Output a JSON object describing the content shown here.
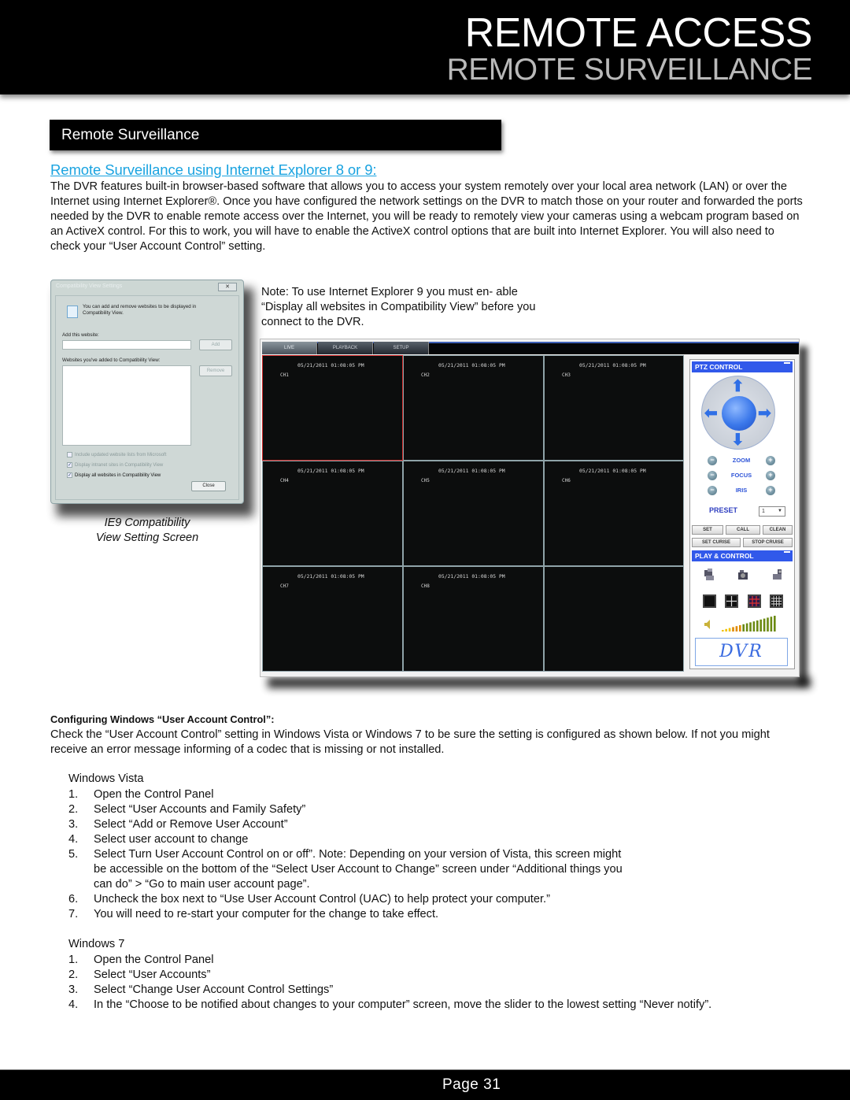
{
  "header": {
    "title": "REMOTE ACCESS",
    "subtitle": "REMOTE SURVEILLANCE"
  },
  "section_bar": {
    "label": "Remote Surveillance"
  },
  "subheading": "Remote Surveillance using Internet Explorer 8 or 9:",
  "intro_paragraph": "The DVR features built-in browser-based software that allows you to access your system remotely over your local area network (LAN) or over the Internet using Internet Explorer®. Once you have configured the network settings on the DVR to match those on your router and forwarded the ports needed by the DVR to enable remote access over the Internet, you will be ready to remotely view your cameras using a webcam program based on an ActiveX control. For this to work, you will have to enable the ActiveX control options that are built into Internet Explorer.  You will also need to check your “User Account Control” setting.",
  "ie9_dialog": {
    "title": "Compatibility View Settings",
    "close_glyph": "✕",
    "info_text": "You can add and remove websites to be displayed in Compatibility View.",
    "add_label": "Add this website:",
    "add_value": "",
    "add_button": "Add",
    "list_label": "Websites you've added to Compatibility View:",
    "remove_button": "Remove",
    "checkboxes": [
      {
        "label": "Include updated website lists from Microsoft",
        "checked": false
      },
      {
        "label": "Display intranet sites in Compatibility View",
        "checked": true
      },
      {
        "label": "Display all websites in Compatibility View",
        "checked": true
      }
    ],
    "close_button": "Close"
  },
  "caption": {
    "line1": "IE9 Compatibility",
    "line2": "View Setting Screen"
  },
  "note": "Note: To use Internet Explorer 9 you must en- able “Display all websites in Compatibility View” before you connect to the DVR.",
  "dvr_app": {
    "tabs": [
      {
        "label": "LIVE",
        "active": true
      },
      {
        "label": "PLAYBACK",
        "active": false
      },
      {
        "label": "SETUP",
        "active": false
      }
    ],
    "cells": [
      {
        "timestamp": "05/21/2011 01:08:05 PM",
        "channel": "CH1",
        "selected": true
      },
      {
        "timestamp": "05/21/2011 01:08:05 PM",
        "channel": "CH2",
        "selected": false
      },
      {
        "timestamp": "05/21/2011 01:08:05 PM",
        "channel": "CH3",
        "selected": false
      },
      {
        "timestamp": "05/21/2011 01:08:05 PM",
        "channel": "CH4",
        "selected": false
      },
      {
        "timestamp": "05/21/2011 01:08:05 PM",
        "channel": "CH5",
        "selected": false
      },
      {
        "timestamp": "05/21/2011 01:08:05 PM",
        "channel": "CH6",
        "selected": false
      },
      {
        "timestamp": "05/21/2011 01:08:05 PM",
        "channel": "CH7",
        "selected": false
      },
      {
        "timestamp": "05/21/2011 01:08:05 PM",
        "channel": "CH8",
        "selected": false
      },
      {
        "timestamp": "",
        "channel": "",
        "selected": false
      }
    ],
    "ptz_header": "PTZ CONTROL",
    "controls": [
      {
        "label": "ZOOM",
        "minus": "−",
        "plus": "+"
      },
      {
        "label": "FOCUS",
        "minus": "−",
        "plus": "+"
      },
      {
        "label": "IRIS",
        "minus": "−",
        "plus": "+"
      }
    ],
    "preset_label": "PRESET",
    "preset_value": "1",
    "buttons": {
      "set": "SET",
      "call": "CALL",
      "clean": "CLEAN",
      "set_cruise": "SET CURISE",
      "stop_cruise": "STOP CRUISE"
    },
    "play_header": "PLAY & CONTROL",
    "logo_text": "DVR",
    "volume_level": 1.0,
    "accent_color": "#3159ea"
  },
  "uac": {
    "heading": "Configuring Windows “User Account Control”:",
    "body": "Check the “User Account Control” setting in Windows Vista or Windows 7 to be sure the setting is configured as shown below. If not you might receive an error message informing of a codec that is missing or not installed.",
    "vista": {
      "title": "Windows Vista",
      "steps": [
        {
          "n": "1.",
          "text": "Open the Control Panel"
        },
        {
          "n": "2.",
          "text": "Select “User Accounts and Family Safety”"
        },
        {
          "n": "3.",
          "text": "Select “Add or Remove User Account”"
        },
        {
          "n": "4.",
          "text": "Select user account to change"
        },
        {
          "n": "5.",
          "text": "Select Turn User Account Control on or off”. Note: Depending on your version of Vista, this screen might be accessible on the bottom of the “Select User Account to Change” screen under “Additional things you can do” > “Go to main user account page”."
        },
        {
          "n": "6.",
          "text": "Uncheck the box next to “Use User Account Control (UAC) to help protect your computer.”"
        },
        {
          "n": "7.",
          "text": "You will need to re-start your computer for the change to take effect."
        }
      ]
    },
    "win7": {
      "title": "Windows 7",
      "steps": [
        {
          "n": "1.",
          "text": "Open the Control Panel"
        },
        {
          "n": "2.",
          "text": "Select “User Accounts”"
        },
        {
          "n": "3.",
          "text": "Select “Change User Account Control Settings”"
        },
        {
          "n": "4.",
          "text": "In the “Choose to be notified about changes to your computer” screen, move the slider to the lowest setting “Never notify”."
        }
      ]
    }
  },
  "footer": {
    "page_label": "Page  31"
  }
}
